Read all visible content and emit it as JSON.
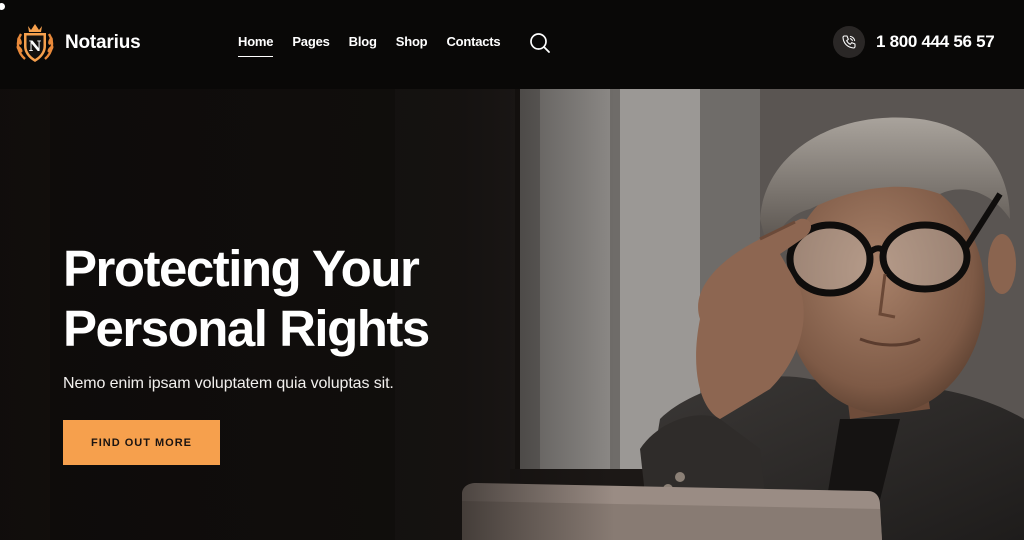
{
  "brand": {
    "name": "Notarius",
    "logo_letter": "N",
    "accent_color": "#f6a04d"
  },
  "nav": {
    "items": [
      {
        "label": "Home",
        "active": true
      },
      {
        "label": "Pages",
        "active": false
      },
      {
        "label": "Blog",
        "active": false
      },
      {
        "label": "Shop",
        "active": false
      },
      {
        "label": "Contacts",
        "active": false
      }
    ]
  },
  "header": {
    "search_icon": "search-icon",
    "phone_icon": "phone-icon",
    "phone_number": "1 800 444 56 57"
  },
  "hero": {
    "title_line1": "Protecting Your",
    "title_line2": "Personal Rights",
    "subtitle": "Nemo enim ipsam voluptatem quia voluptas sit.",
    "cta_label": "FIND OUT MORE"
  }
}
